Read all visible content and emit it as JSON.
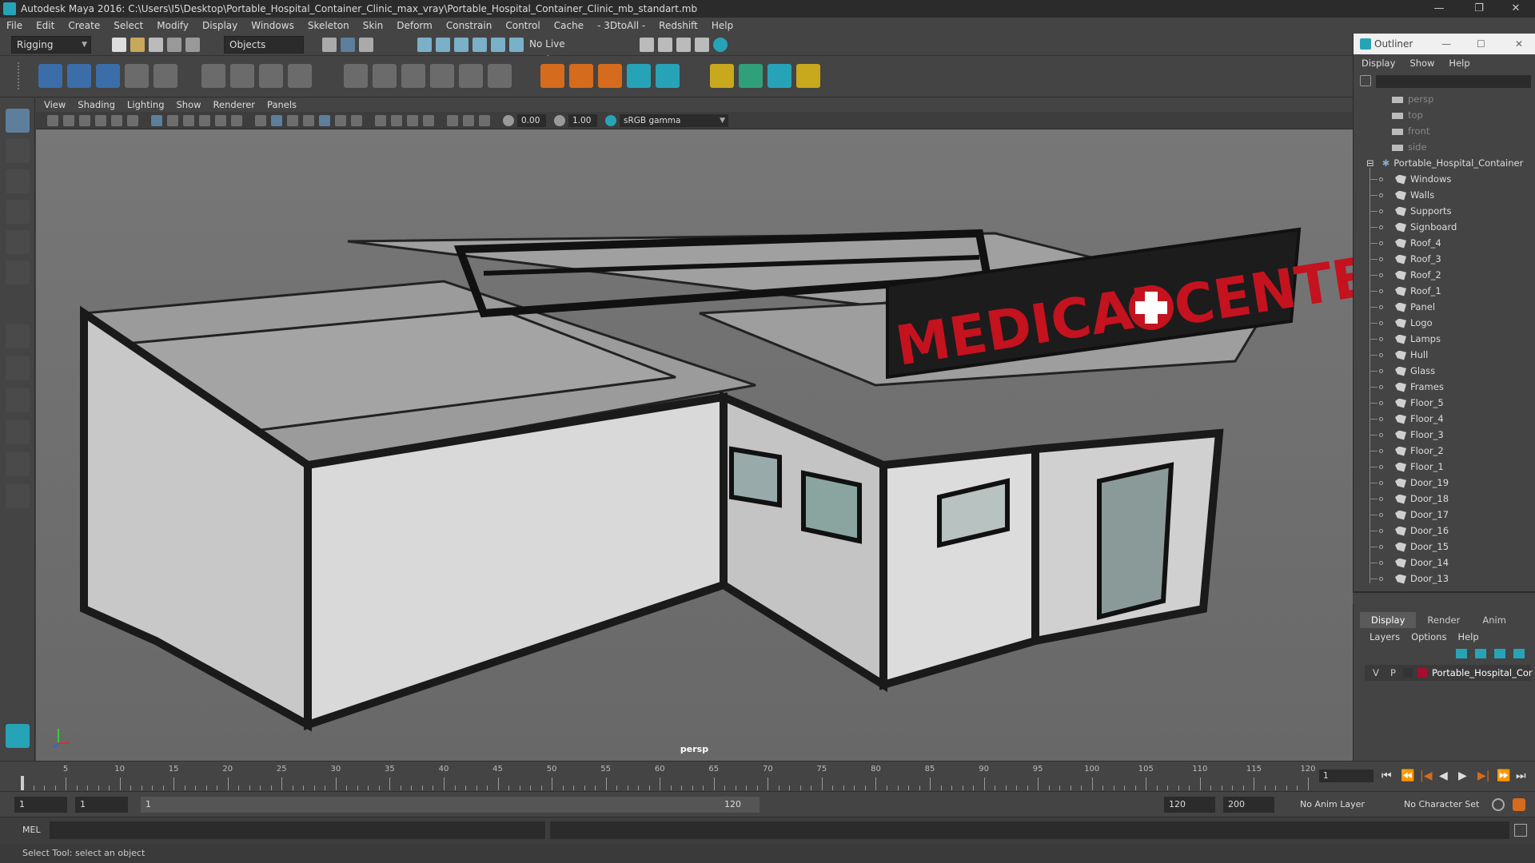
{
  "title": "Autodesk Maya 2016: C:\\Users\\I5\\Desktop\\Portable_Hospital_Container_Clinic_max_vray\\Portable_Hospital_Container_Clinic_mb_standart.mb",
  "window_controls": {
    "min": "—",
    "max": "❐",
    "close": "✕"
  },
  "menu": [
    "File",
    "Edit",
    "Create",
    "Select",
    "Modify",
    "Display",
    "Windows",
    "Skeleton",
    "Skin",
    "Deform",
    "Constrain",
    "Control",
    "Cache",
    "- 3DtoAll -",
    "Redshift",
    "Help"
  ],
  "status": {
    "mode": "Rigging",
    "selection_mode": "Objects",
    "live_surface": "No Live Surface"
  },
  "panel_menu": [
    "View",
    "Shading",
    "Lighting",
    "Show",
    "Renderer",
    "Panels"
  ],
  "panel_toolbar": {
    "value_a": "0.00",
    "value_b": "1.00",
    "color_space": "sRGB gamma"
  },
  "viewport": {
    "camera": "persp",
    "sign_text": "MEDICAL",
    "sign_text2": "CENTER",
    "sign_color": "#c4121f"
  },
  "outliner": {
    "title": "Outliner",
    "menu": [
      "Display",
      "Show",
      "Help"
    ],
    "cameras": [
      "persp",
      "top",
      "front",
      "side"
    ],
    "root": "Portable_Hospital_Container",
    "children": [
      "Windows",
      "Walls",
      "Supports",
      "Signboard",
      "Roof_4",
      "Roof_3",
      "Roof_2",
      "Roof_1",
      "Panel",
      "Logo",
      "Lamps",
      "Hull",
      "Glass",
      "Frames",
      "Floor_5",
      "Floor_4",
      "Floor_3",
      "Floor_2",
      "Floor_1",
      "Door_19",
      "Door_18",
      "Door_17",
      "Door_16",
      "Door_15",
      "Door_14",
      "Door_13"
    ]
  },
  "layer_editor": {
    "tabs": [
      "Display",
      "Render",
      "Anim"
    ],
    "menu": [
      "Layers",
      "Options",
      "Help"
    ],
    "layer": {
      "v": "V",
      "p": "P",
      "name": "Portable_Hospital_Cor",
      "color": "#a50e2e"
    }
  },
  "timeslider": {
    "ticks": [
      5,
      10,
      15,
      20,
      25,
      30,
      35,
      40,
      45,
      50,
      55,
      60,
      65,
      70,
      75,
      80,
      85,
      90,
      95,
      100,
      105,
      110,
      115,
      120
    ],
    "current_frame": "1",
    "first_tick": "1"
  },
  "range": {
    "start": "1",
    "start2": "1",
    "slider_start": "1",
    "slider_end": "120",
    "end": "120",
    "end2": "200",
    "anim_layer": "No Anim Layer",
    "char_set": "No Character Set"
  },
  "cmd": {
    "label": "MEL"
  },
  "help_line": "Select Tool: select an object"
}
